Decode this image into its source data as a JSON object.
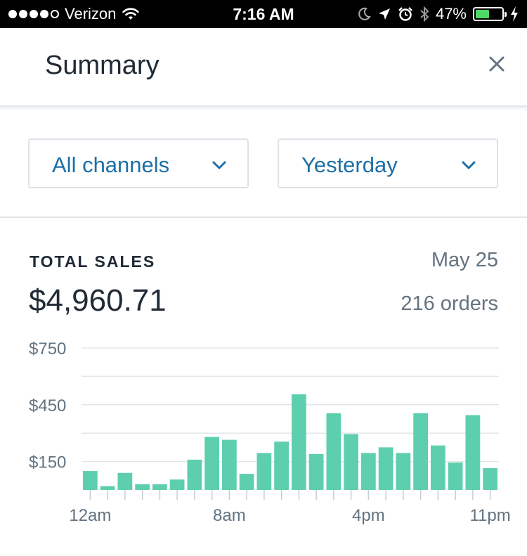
{
  "status_bar": {
    "carrier": "Verizon",
    "time": "7:16 AM",
    "battery": "47%",
    "battery_level": 0.47,
    "icons": [
      "signal-dots-icon",
      "wifi-icon",
      "moon-icon",
      "location-arrow-icon",
      "alarm-icon",
      "bluetooth-icon",
      "battery-icon",
      "charging-bolt-icon"
    ]
  },
  "header": {
    "title": "Summary",
    "close_icon": "close-icon"
  },
  "filters": {
    "channel": {
      "label": "All channels",
      "icon": "chevron-down-icon"
    },
    "period": {
      "label": "Yesterday",
      "icon": "chevron-down-icon"
    }
  },
  "summary": {
    "title": "TOTAL SALES",
    "date": "May 25",
    "total": "$4,960.71",
    "orders": "216 orders"
  },
  "colors": {
    "accent": "#1c6fa6",
    "bar": "#5ecfae",
    "muted": "#637381",
    "grid": "#e3e6e9"
  },
  "chart_data": {
    "type": "bar",
    "categories": [
      "12am",
      "1am",
      "2am",
      "3am",
      "4am",
      "5am",
      "6am",
      "7am",
      "8am",
      "9am",
      "10am",
      "11am",
      "12pm",
      "1pm",
      "2pm",
      "3pm",
      "4pm",
      "5pm",
      "6pm",
      "7pm",
      "8pm",
      "9pm",
      "10pm",
      "11pm"
    ],
    "values": [
      100,
      20,
      90,
      30,
      30,
      55,
      160,
      280,
      265,
      85,
      195,
      255,
      505,
      190,
      405,
      295,
      195,
      225,
      195,
      405,
      235,
      145,
      395,
      115
    ],
    "ylim": [
      0,
      750
    ],
    "yticks": [
      {
        "value": 750,
        "label": "$750"
      },
      {
        "value": 450,
        "label": "$450"
      },
      {
        "value": 150,
        "label": "$150"
      }
    ],
    "gridlines": [
      750,
      600,
      450,
      300,
      150
    ],
    "xticklabels": [
      {
        "index": 0,
        "label": "12am"
      },
      {
        "index": 8,
        "label": "8am"
      },
      {
        "index": 16,
        "label": "4pm"
      },
      {
        "index": 23,
        "label": "11pm"
      }
    ]
  }
}
